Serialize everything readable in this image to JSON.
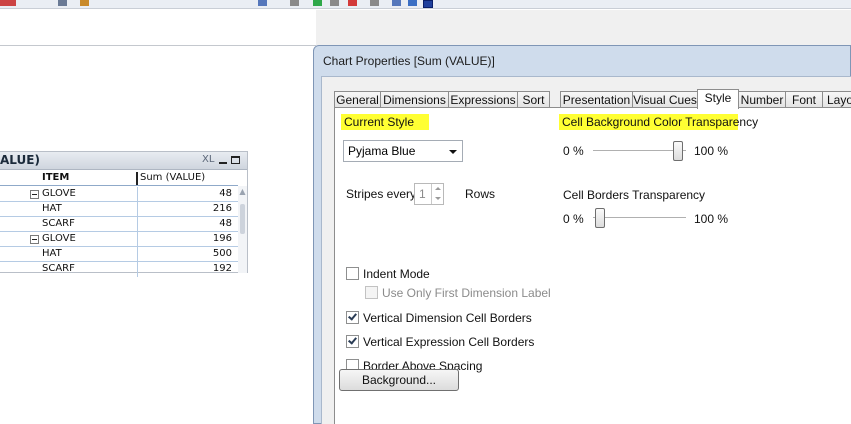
{
  "sheet_object": {
    "title": "ALUE)",
    "xl_label": "XL",
    "columns": [
      "ITEM",
      "Sum (VALUE)"
    ],
    "rows": [
      {
        "item": "GLOVE",
        "value": "48",
        "expand": true
      },
      {
        "item": "HAT",
        "value": "216",
        "expand": false
      },
      {
        "item": "SCARF",
        "value": "48",
        "expand": false
      },
      {
        "item": "GLOVE",
        "value": "196",
        "expand": true
      },
      {
        "item": "HAT",
        "value": "500",
        "expand": false
      },
      {
        "item": "SCARF",
        "value": "192",
        "expand": false
      }
    ]
  },
  "dialog": {
    "title": "Chart Properties [Sum (VALUE)]",
    "tabs": [
      "General",
      "Dimensions",
      "Expressions",
      "Sort",
      "Presentation",
      "Visual Cues",
      "Style",
      "Number",
      "Font",
      "Layo"
    ],
    "active_tab": "Style",
    "current_style_label": "Current Style",
    "current_style_value": "Pyjama Blue",
    "stripes_label": "Stripes every",
    "stripes_value": "1",
    "rows_label": "Rows",
    "cell_bg_label": "Cell Background Color Transparency",
    "cell_bg_min": "0 %",
    "cell_bg_max": "100 %",
    "cell_bg_value_percent": 100,
    "cell_borders_label": "Cell Borders Transparency",
    "cell_borders_min": "0 %",
    "cell_borders_max": "100 %",
    "cell_borders_value_percent": 0,
    "options": [
      {
        "label": "Indent Mode",
        "checked": false,
        "disabled": false
      },
      {
        "label": "Use Only First Dimension Label",
        "checked": false,
        "disabled": true
      },
      {
        "label": "Vertical Dimension Cell Borders",
        "checked": true,
        "disabled": false
      },
      {
        "label": "Vertical Expression Cell Borders",
        "checked": true,
        "disabled": false
      },
      {
        "label": "Border Above Spacing",
        "checked": false,
        "disabled": false
      }
    ],
    "background_button": "Background..."
  },
  "colors": {
    "highlight": "#ffff33",
    "dialog_frame": "#cfdcec",
    "table_header": "#e8ecf1",
    "help_icon": "#1f3f9c"
  }
}
